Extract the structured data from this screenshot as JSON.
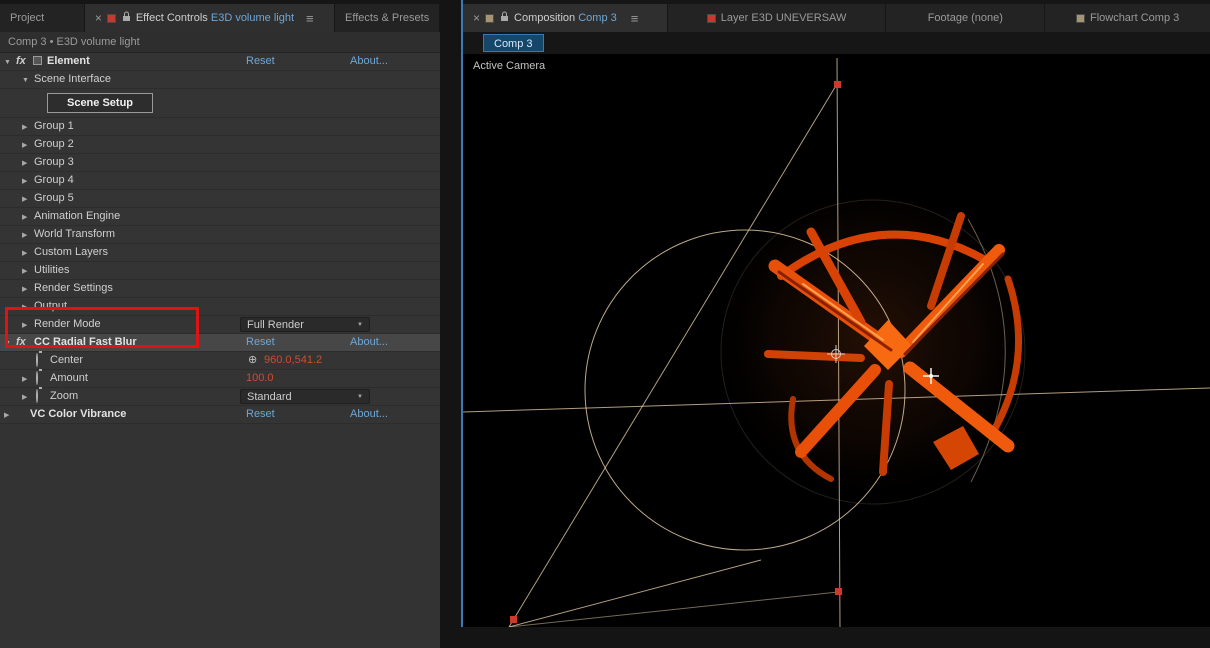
{
  "left_tabs": {
    "project": "Project",
    "close": "×",
    "effect_controls": "Effect Controls",
    "effect_target": "E3D volume light",
    "menu": "≡",
    "effects_presets": "Effects & Presets"
  },
  "effect_controls": {
    "breadcrumb": "Comp 3 • E3D volume light",
    "element": {
      "fx": "fx",
      "name": "Element",
      "reset": "Reset",
      "about": "About...",
      "scene_interface": "Scene Interface",
      "scene_setup": "Scene Setup",
      "groups": [
        "Group 1",
        "Group 2",
        "Group 3",
        "Group 4",
        "Group 5"
      ],
      "sections": [
        "Animation Engine",
        "World Transform",
        "Custom Layers",
        "Utilities",
        "Render Settings",
        "Output"
      ],
      "render_mode_label": "Render Mode",
      "render_mode_value": "Full Render"
    },
    "cc": {
      "name": "CC Radial Fast Blur",
      "reset": "Reset",
      "about": "About...",
      "center_label": "Center",
      "center_value": "960.0,541.2",
      "amount_label": "Amount",
      "amount_value": "100.0",
      "zoom_label": "Zoom",
      "zoom_value": "Standard"
    },
    "vc": {
      "name": "VC Color Vibrance",
      "reset": "Reset",
      "about": "About..."
    }
  },
  "right_tabs": {
    "close": "×",
    "composition": "Composition",
    "composition_target": "Comp 3",
    "menu": "≡",
    "layer": "Layer",
    "layer_target": "E3D UNEVERSAW",
    "footage": "Footage",
    "footage_target": "(none)",
    "flowchart": "Flowchart",
    "flowchart_target": "Comp 3"
  },
  "composition": {
    "comp_tab": "Comp 3",
    "view_label": "Active Camera"
  },
  "colors": {
    "accent_blue": "#6ea7d8",
    "panel_focus_blue": "#3a7ab8",
    "value_red": "#c8502e",
    "annotation_red": "#e01212",
    "shard_orange": "#e8500a",
    "wireframe_peach": "#ecd2ab"
  }
}
